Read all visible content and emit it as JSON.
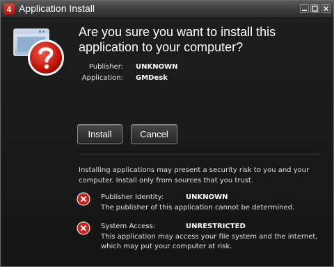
{
  "window": {
    "title": "Application Install",
    "logo_icon": "air-logo-icon",
    "logo_text": "4"
  },
  "dialog": {
    "heading": "Are you sure you want to install this application to your computer?",
    "publisher_label": "Publisher:",
    "publisher_value": "UNKNOWN",
    "application_label": "Application:",
    "application_value": "GMDesk",
    "install_button": "Install",
    "cancel_button": "Cancel",
    "warning": "Installing applications may present a security risk to you and your computer. Install only from sources that you trust.",
    "risks": [
      {
        "label": "Publisher Identity:",
        "value": "UNKNOWN",
        "description": "The publisher of this application cannot be determined.",
        "icon": "error-x-icon"
      },
      {
        "label": "System Access:",
        "value": "UNRESTRICTED",
        "description": "This application may access your file system and the internet, which may put your computer at risk.",
        "icon": "error-x-icon"
      }
    ]
  },
  "colors": {
    "accent_red": "#c8251b",
    "background": "#1a1a1a",
    "text": "#ffffff"
  }
}
